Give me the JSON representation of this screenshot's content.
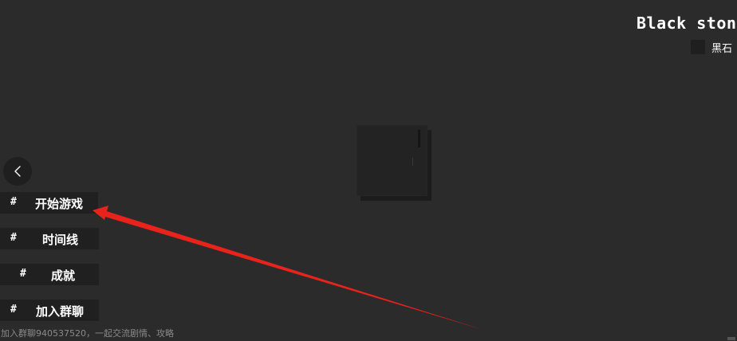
{
  "item": {
    "title": "Black stone",
    "name": "黑石"
  },
  "menu": {
    "items": [
      {
        "hash": "#",
        "label": "开始游戏"
      },
      {
        "hash": "#",
        "label": "时间线"
      },
      {
        "hash": "#",
        "label": "成就"
      },
      {
        "hash": "#",
        "label": "加入群聊"
      }
    ]
  },
  "footer": {
    "text": "加入群聊940537520，一起交流剧情、攻略"
  },
  "colors": {
    "background": "#2b2b2b",
    "button": "#202020",
    "annotation_arrow": "#e8231c"
  }
}
